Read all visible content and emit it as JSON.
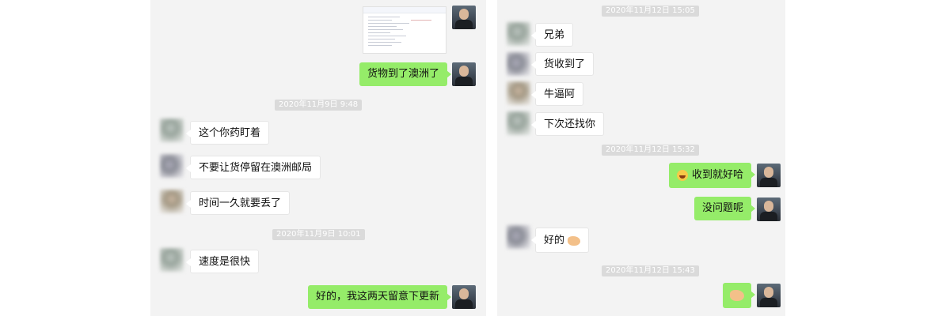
{
  "left_panel": {
    "messages": [
      {
        "text": "货物到了澳洲了"
      },
      {
        "text": "这个你药盯着"
      },
      {
        "text": "不要让货停留在澳洲邮局"
      },
      {
        "text": "时间一久就要丢了"
      },
      {
        "text": "速度是很快"
      },
      {
        "text": "好的，我这两天留意下更新"
      }
    ],
    "timestamps": [
      "2020年11月9日 9:48",
      "2020年11月9日 10:01"
    ]
  },
  "right_panel": {
    "messages": [
      {
        "text": "兄弟"
      },
      {
        "text": "货收到了"
      },
      {
        "text": "牛逼阿"
      },
      {
        "text": "下次还找你"
      },
      {
        "text": "收到就好哈"
      },
      {
        "text": "没问题呢"
      },
      {
        "text": "好的"
      }
    ],
    "timestamps": [
      "2020年11月12日 15:05",
      "2020年11月12日 15:32",
      "2020年11月12日 15:43"
    ]
  },
  "colors": {
    "panel_bg": "#f3f3f3",
    "sent_bubble": "#95ec69",
    "received_bubble": "#ffffff",
    "timestamp_bg": "#dadada"
  },
  "icons": [
    "laughing-tears-emoji-icon",
    "clapping-hands-emoji-icon",
    "user-avatar-icon"
  ]
}
